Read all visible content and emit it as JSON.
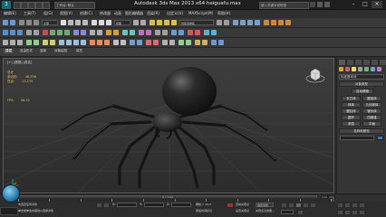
{
  "window": {
    "title": "Autodesk 3ds Max  2013 x64     heiguafu.max",
    "workspace_label": "工作台: 默认",
    "search_placeholder": "键入关键字或短语",
    "logo_text": "3"
  },
  "menu": {
    "items": [
      "编辑(E)",
      "工具(T)",
      "组(G)",
      "视图(V)",
      "创建(C)",
      "修改器",
      "动画",
      "图形编辑器",
      "渲染(R)",
      "自定义(U)",
      "MAXScript(M)",
      "帮助(H)"
    ]
  },
  "toolbar": {
    "selection_filter": "全部",
    "view_dropdown": "视图",
    "named_selection": "创建选择集"
  },
  "ribbon": {
    "tabs": [
      "建模",
      "自由形式",
      "选择",
      "对象绘制",
      "填充"
    ]
  },
  "viewport": {
    "label": "[+] [透视] [真实]",
    "stats": [
      {
        "label": "总计",
        "value": ""
      },
      {
        "label": "多边形:",
        "value": "46,336"
      },
      {
        "label": "顶点:",
        "value": "23,170"
      }
    ],
    "fps_label": "FPS:",
    "fps_value": "36.32"
  },
  "command_panel": {
    "object_combo": "标准基本体",
    "rollout_object_type": "对象类型",
    "auto_grid": "自动栅格",
    "buttons": [
      "长方体",
      "圆锥体",
      "球体",
      "几何球体",
      "圆柱体",
      "管状体",
      "圆环",
      "四棱锥",
      "茶壶",
      "平面"
    ],
    "rollout_name_color": "名称和颜色"
  },
  "timeline": {
    "frame_text": "0 / 100",
    "ticks": [
      "0",
      "10",
      "20",
      "30",
      "40",
      "50",
      "60",
      "70",
      "80",
      "90",
      "100"
    ]
  },
  "status": {
    "selected": "未选定任何对象",
    "prompt": "单击或单击并拖动以选择对象",
    "x_label": "X:",
    "y_label": "Y:",
    "z_label": "Z:",
    "grid": "栅格 = 10.0",
    "add_time_tag": "添加时间标记",
    "auto_key": "自动关键点",
    "set_key": "设置关键点",
    "selected_set": "选定对象",
    "key_filters": "关键点过滤器..."
  },
  "colors": {
    "accent": "#5fa0d8",
    "viewport_bg": "#3a3a3a",
    "spider": "#1c1c1c"
  }
}
